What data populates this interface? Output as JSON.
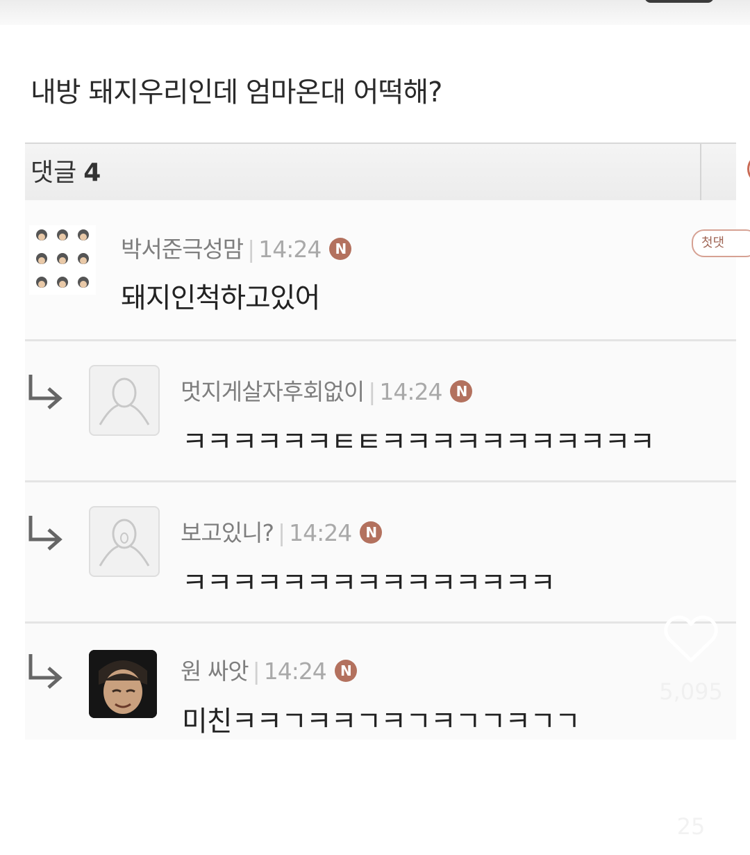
{
  "post": {
    "title": "내방 돼지우리인데 엄마온대 어떡해?"
  },
  "comment_header": {
    "label": "댓글",
    "count": "4"
  },
  "comments": [
    {
      "author": "박서준극성맘",
      "time": "14:24",
      "badge": "N",
      "tag": "첫댓",
      "text": "돼지인척하고있어"
    },
    {
      "author": "멋지게살자후회없이",
      "time": "14:24",
      "badge": "N",
      "text": "ㅋㅋㅋㅋㅋㅋㅌㅌㅋㅋㅋㅋㅋㅋㅋㅋㅋㅋㅋ"
    },
    {
      "author": "보고있니?",
      "time": "14:24",
      "badge": "N",
      "text": "ㅋㅋㅋㅋㅋㅋㅋㅋㅋㅋㅋㅋㅋㅋㅋ"
    },
    {
      "author": "원 싸앗",
      "time": "14:24",
      "badge": "N",
      "text": "미친ㅋㅋㄱㅋㅋㄱㅋㄱㅋㄱㄱㅋㄱㄱ"
    }
  ],
  "actions": {
    "likes": "5,095",
    "comments": "25"
  },
  "icons": {
    "like": "heart-icon",
    "comment": "comment-bubble-icon",
    "reply": "reply-arrow-icon",
    "new": "new-badge-icon"
  }
}
